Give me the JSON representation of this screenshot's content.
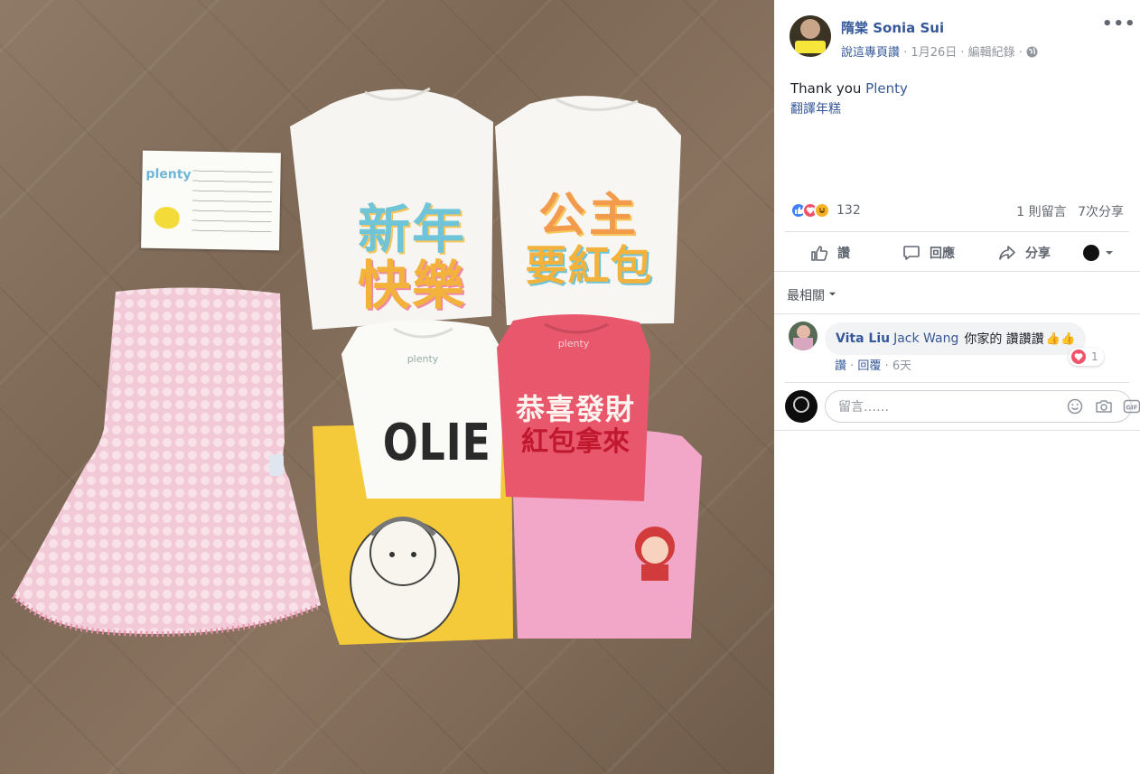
{
  "photo": {
    "card": {
      "brand": "plenty"
    },
    "shirt1": {
      "line1": "新年",
      "line2": "快樂"
    },
    "shirt2": {
      "line1": "公主",
      "line2": "要紅包"
    },
    "onesie_white": {
      "brand": "plenty",
      "text": "OLIE"
    },
    "onesie_red": {
      "brand": "plenty",
      "line1": "恭喜發財",
      "line2": "紅包拿來"
    }
  },
  "post": {
    "author": "隋棠 Sonia Sui",
    "like_page": "說這專頁讚",
    "date": "1月26日",
    "edit_history": "編輯紀錄",
    "text": "Thank you ",
    "mention": "Plenty",
    "translate": "翻譯年糕",
    "reaction_count": "132",
    "comments_count": "1 則留言",
    "shares_count": "7次分享",
    "actions": {
      "like": "讚",
      "comment": "回應",
      "share": "分享"
    },
    "sort": "最相關"
  },
  "comment": {
    "author": "Vita Liu",
    "tag": "Jack Wang",
    "text": "你家的  讚讚讚",
    "emoji": "👍👍",
    "like": "讚",
    "reply": "回覆",
    "time": "6天",
    "heart_count": "1"
  },
  "composer": {
    "placeholder": "留言……"
  },
  "colors": {
    "link": "#365899",
    "muted": "#90949c",
    "like_blue": "#4080ff",
    "love_red": "#f25268",
    "haha_yellow": "#f7b125"
  }
}
